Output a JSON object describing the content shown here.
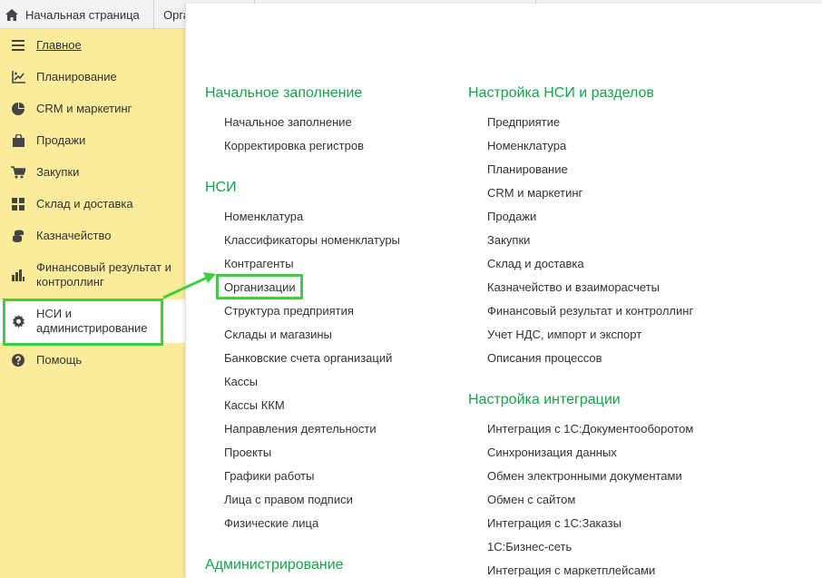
{
  "tabs": {
    "home_label": "Начальная страница",
    "org_label": "Организации"
  },
  "sidebar": {
    "items": [
      {
        "label": "Главное"
      },
      {
        "label": "Планирование"
      },
      {
        "label": "CRM и маркетинг"
      },
      {
        "label": "Продажи"
      },
      {
        "label": "Закупки"
      },
      {
        "label": "Склад и доставка"
      },
      {
        "label": "Казначейство"
      },
      {
        "label": "Финансовый результат и контроллинг"
      },
      {
        "label": "НСИ и администрирование"
      },
      {
        "label": "Помощь"
      }
    ]
  },
  "colors": {
    "sidebar_bg": "#fbec9c",
    "section_title": "#17a34a",
    "highlight": "#3cd13c"
  },
  "left_column": {
    "sections": [
      {
        "title": "Начальное заполнение",
        "links": [
          "Начальное заполнение",
          "Корректировка регистров"
        ]
      },
      {
        "title": "НСИ",
        "links": [
          "Номенклатура",
          "Классификаторы номенклатуры",
          "Контрагенты",
          "Организации",
          "Структура предприятия",
          "Склады и магазины",
          "Банковские счета организаций",
          "Кассы",
          "Кассы ККМ",
          "Направления деятельности",
          "Проекты",
          "Графики работы",
          "Лица с правом подписи",
          "Физические лица"
        ]
      },
      {
        "title": "Администрирование",
        "links": []
      }
    ]
  },
  "right_column": {
    "sections": [
      {
        "title": "Настройка НСИ и разделов",
        "links": [
          "Предприятие",
          "Номенклатура",
          "Планирование",
          "CRM и маркетинг",
          "Продажи",
          "Закупки",
          "Склад и доставка",
          "Казначейство и взаиморасчеты",
          "Финансовый результат и контроллинг",
          "Учет НДС, импорт и экспорт",
          "Описания процессов"
        ]
      },
      {
        "title": "Настройка интеграции",
        "links": [
          "Интеграция с 1С:Документооборотом",
          "Синхронизация данных",
          "Обмен электронными документами",
          "Обмен с сайтом",
          "Интеграция с 1С:Заказы",
          "1С:Бизнес-сеть",
          "Интеграция с маркетплейсами"
        ]
      }
    ]
  }
}
